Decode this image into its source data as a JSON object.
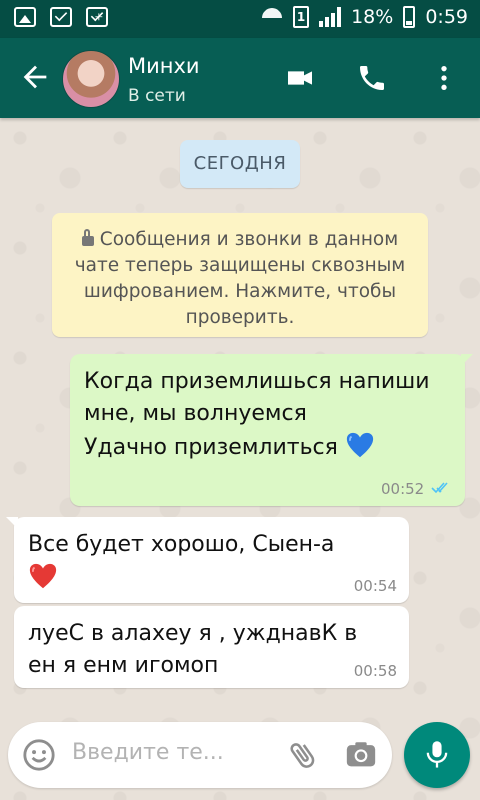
{
  "status_bar": {
    "battery": "18%",
    "time": "0:59",
    "sim": "1"
  },
  "header": {
    "contact_name": "Минхи",
    "contact_status": "В сети"
  },
  "chat": {
    "date_label": "СЕГОДНЯ",
    "encryption_notice": "Сообщения и звонки в данном чате теперь защищены сквозным шифрованием. Нажмите, чтобы проверить.",
    "messages": [
      {
        "direction": "outgoing",
        "lines": [
          "Когда приземлишься напиши",
          "мне, мы волнуемся",
          "Удачно приземлиться"
        ],
        "emoji": "blue-heart",
        "time": "00:52",
        "status": "read"
      },
      {
        "direction": "incoming",
        "lines": [
          "Все будет хорошо, Сыен-а"
        ],
        "emoji": "red-heart",
        "time": "00:54"
      },
      {
        "direction": "incoming",
        "lines": [
          "луеС в алахеу я , ужднавК в",
          "ен я енм игомоп"
        ],
        "time": "00:58"
      }
    ]
  },
  "composer": {
    "placeholder": "Введите те..."
  },
  "colors": {
    "header": "#075e54",
    "status_bar": "#054d44",
    "outgoing_bubble": "#dcf8c6",
    "incoming_bubble": "#ffffff",
    "date_chip": "#d3e9f7",
    "notice": "#fdf4c5",
    "mic_button": "#00897b"
  }
}
